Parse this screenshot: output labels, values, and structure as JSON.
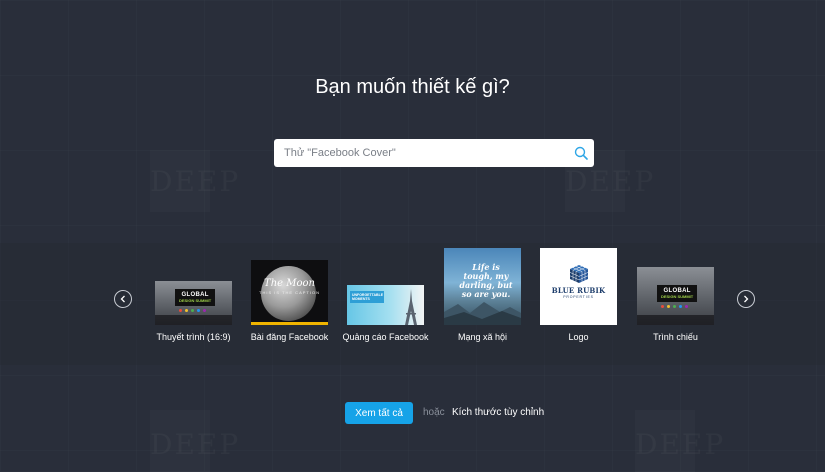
{
  "header": {
    "title": "Bạn muốn thiết kế gì?"
  },
  "search": {
    "placeholder": "Thử \"Facebook Cover\"",
    "icon": "search-icon"
  },
  "carousel": {
    "prev_icon": "chevron-left-icon",
    "next_icon": "chevron-right-icon",
    "items": [
      {
        "label": "Thuyết trình (16:9)",
        "thumb_logo": "GLOBAL",
        "thumb_logo_sub": "DESIGN SUMMIT"
      },
      {
        "label": "Bài đăng Facebook",
        "thumb_title": "The Moon",
        "thumb_sub": "THIS IS THE CAPTION"
      },
      {
        "label": "Quảng cáo Facebook",
        "thumb_tag": "UNFORGETTABLE MOMENTS"
      },
      {
        "label": "Mạng xã hội",
        "thumb_quote": "Life is tough, my darling, but so are you."
      },
      {
        "label": "Logo",
        "thumb_brand": "BLUE RUBIK",
        "thumb_brand_sub": "PROPERTIES"
      },
      {
        "label": "Trình chiếu",
        "thumb_logo": "GLOBAL",
        "thumb_logo_sub": "DESIGN SUMMIT"
      }
    ]
  },
  "footer": {
    "see_all_label": "Xem tất cả",
    "or_label": "hoặc",
    "custom_size_label": "Kích thước tùy chỉnh"
  },
  "colors": {
    "background": "#2c313d",
    "accent": "#16a3e8",
    "moon_bar": "#f0b400",
    "logo_blue": "#1d3d6b"
  }
}
